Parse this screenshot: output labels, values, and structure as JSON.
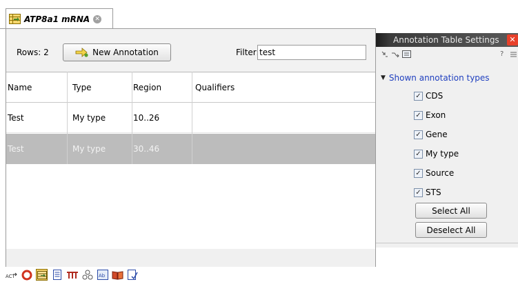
{
  "tab": {
    "title": "ATP8a1 mRNA",
    "close_glyph": "✕"
  },
  "toolbar": {
    "rows_label": "Rows: 2",
    "new_annotation_label": "New Annotation",
    "filter_label": "Filter:",
    "filter_value": "test"
  },
  "table": {
    "columns": [
      "Name",
      "Type",
      "Region",
      "Qualifiers"
    ],
    "rows": [
      {
        "name": "Test",
        "type": "My type",
        "region": "10..26",
        "qualifiers": "",
        "selected": false
      },
      {
        "name": "Test",
        "type": "My type",
        "region": "30..46",
        "qualifiers": "",
        "selected": true
      }
    ]
  },
  "side_panel": {
    "title": "Annotation Table Settings",
    "close_glyph": "✕",
    "help_glyph": "?",
    "section_title": "Shown annotation types",
    "types": [
      {
        "label": "CDS",
        "checked": true
      },
      {
        "label": "Exon",
        "checked": true
      },
      {
        "label": "Gene",
        "checked": true
      },
      {
        "label": "My type",
        "checked": true
      },
      {
        "label": "Source",
        "checked": true
      },
      {
        "label": "STS",
        "checked": true
      }
    ],
    "select_all_label": "Select All",
    "deselect_all_label": "Deselect All"
  },
  "bottom_icons": [
    "abc-sequence-icon",
    "circular-view-icon",
    "annotation-table-icon",
    "text-view-icon",
    "bar-chart-icon",
    "structure-icon",
    "elements-icon",
    "book-icon",
    "history-icon"
  ],
  "colors": {
    "selected_row": "#bcbcbc",
    "section_link": "#1f3fbf",
    "close_red": "#e8402a"
  }
}
